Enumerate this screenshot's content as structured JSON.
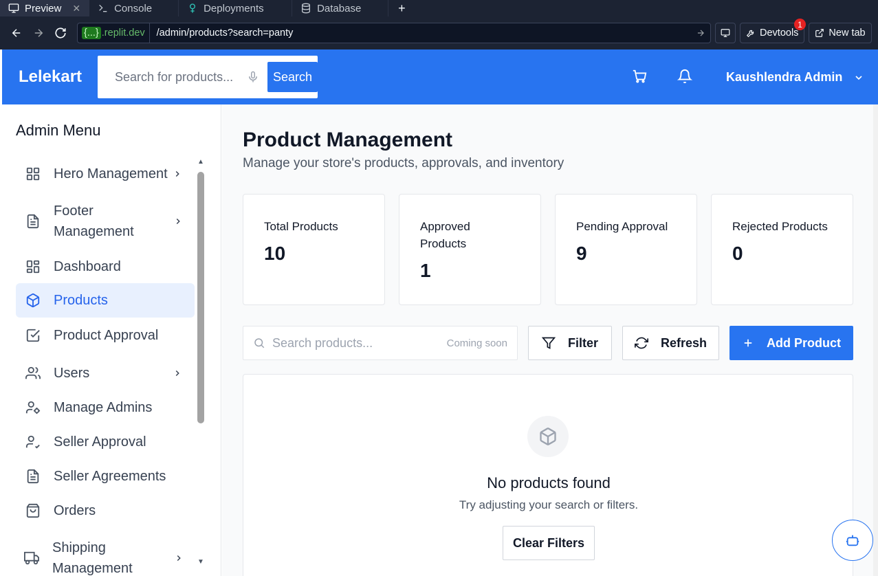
{
  "browser": {
    "tabs": [
      {
        "label": "Preview",
        "icon": "monitor-icon"
      },
      {
        "label": "Console",
        "icon": "terminal-icon"
      },
      {
        "label": "Deployments",
        "icon": "deploy-icon"
      },
      {
        "label": "Database",
        "icon": "database-icon"
      }
    ],
    "new_tab_symbol": "+",
    "url_host_chip": "{...}",
    "url_host": ".replit.dev",
    "url_path": "/admin/products?search=panty",
    "devtools_label": "Devtools",
    "devtools_badge": "1",
    "new_tab_label": "New tab"
  },
  "header": {
    "logo": "Lelekart",
    "search_placeholder": "Search for products...",
    "search_button": "Search",
    "user_name": "Kaushlendra Admin"
  },
  "sidebar": {
    "title": "Admin Menu",
    "items": [
      {
        "label": "Hero Management",
        "icon": "grid-icon",
        "has_chevron": true
      },
      {
        "label": "Footer Management",
        "icon": "document-icon",
        "has_chevron": true
      },
      {
        "label": "Dashboard",
        "icon": "dashboard-icon",
        "has_chevron": false
      },
      {
        "label": "Products",
        "icon": "package-icon",
        "has_chevron": false,
        "active": true
      },
      {
        "label": "Product Approval",
        "icon": "check-square-icon",
        "has_chevron": false
      },
      {
        "label": "Users",
        "icon": "users-icon",
        "has_chevron": true
      },
      {
        "label": "Manage Admins",
        "icon": "user-cog-icon",
        "has_chevron": false
      },
      {
        "label": "Seller Approval",
        "icon": "user-check-icon",
        "has_chevron": false
      },
      {
        "label": "Seller Agreements",
        "icon": "document-icon",
        "has_chevron": false
      },
      {
        "label": "Orders",
        "icon": "shopping-bag-icon",
        "has_chevron": false
      },
      {
        "label": "Shipping Management",
        "icon": "truck-icon",
        "has_chevron": true
      }
    ]
  },
  "main": {
    "title": "Product Management",
    "subtitle": "Manage your store's products, approvals, and inventory",
    "stats": [
      {
        "label": "Total Products",
        "value": "10"
      },
      {
        "label": "Approved Products",
        "value": "1"
      },
      {
        "label": "Pending Approval",
        "value": "9"
      },
      {
        "label": "Rejected Products",
        "value": "0"
      }
    ],
    "search_placeholder": "Search products...",
    "search_note": "Coming soon",
    "filter_button": "Filter",
    "refresh_button": "Refresh",
    "add_button": "Add Product",
    "empty_title": "No products found",
    "empty_subtitle": "Try adjusting your search or filters.",
    "clear_filters_button": "Clear Filters"
  },
  "colors": {
    "brand_blue": "#2874f0",
    "active_bg": "#e8f0fe",
    "active_text": "#2563eb",
    "chrome_bg": "#1c2333"
  }
}
